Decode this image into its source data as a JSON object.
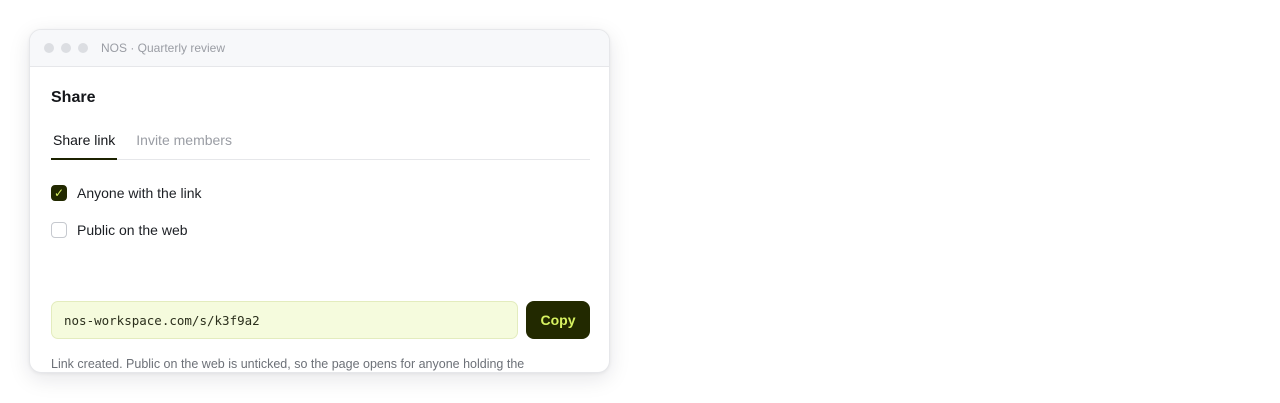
{
  "window": {
    "title": "NOS · Quarterly review"
  },
  "dialog": {
    "heading": "Share",
    "tabs": [
      {
        "label": "Share link",
        "active": true
      },
      {
        "label": "Invite members",
        "active": false
      }
    ],
    "options": [
      {
        "label": "Anyone with the link",
        "checked": true
      },
      {
        "label": "Public on the web",
        "checked": false
      }
    ],
    "link": {
      "value": "nos-workspace.com/s/k3f9a2"
    },
    "copy_label": "Copy",
    "checkmark": "✓",
    "note": "Link created. Public on the web is unticked, so the page opens for anyone holding the address and appears in no search result."
  },
  "colors": {
    "accent_dark": "#222900",
    "accent_lime": "#d7f261",
    "link_field_bg": "#f5fbdd"
  },
  "icons": {
    "checkbox_checked": "check-icon",
    "window_controls": "traffic-light-dots"
  }
}
